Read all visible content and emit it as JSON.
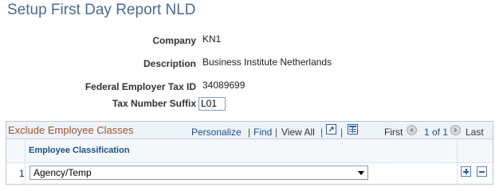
{
  "page": {
    "title": "Setup First Day Report NLD"
  },
  "fields": {
    "company": {
      "label": "Company",
      "value": "KN1"
    },
    "description": {
      "label": "Description",
      "value": "Business Institute Netherlands"
    },
    "federal_employer_tax_id": {
      "label": "Federal Employer Tax ID",
      "value": "34089699"
    },
    "tax_number_suffix": {
      "label": "Tax Number Suffix",
      "value": "L01"
    }
  },
  "grid": {
    "title": "Exclude Employee Classes",
    "nav": {
      "personalize": "Personalize",
      "find": "Find",
      "view_all": "View All",
      "first": "First",
      "range": "1 of 1",
      "last": "Last"
    },
    "columns": [
      "Employee Classification"
    ],
    "rows": [
      {
        "num": "1",
        "classification": "Agency/Temp"
      }
    ],
    "icons": {
      "zoom": "zoom-grid-icon",
      "download": "download-excel-icon",
      "prev": "previous-arrow-icon",
      "next": "next-arrow-icon",
      "add": "add-row-icon",
      "delete": "delete-row-icon"
    }
  },
  "colors": {
    "title": "#4a6a8a",
    "grid_title": "#a0522d",
    "link": "#1a4f8a",
    "grid_header_bg": "#eef3f8"
  }
}
